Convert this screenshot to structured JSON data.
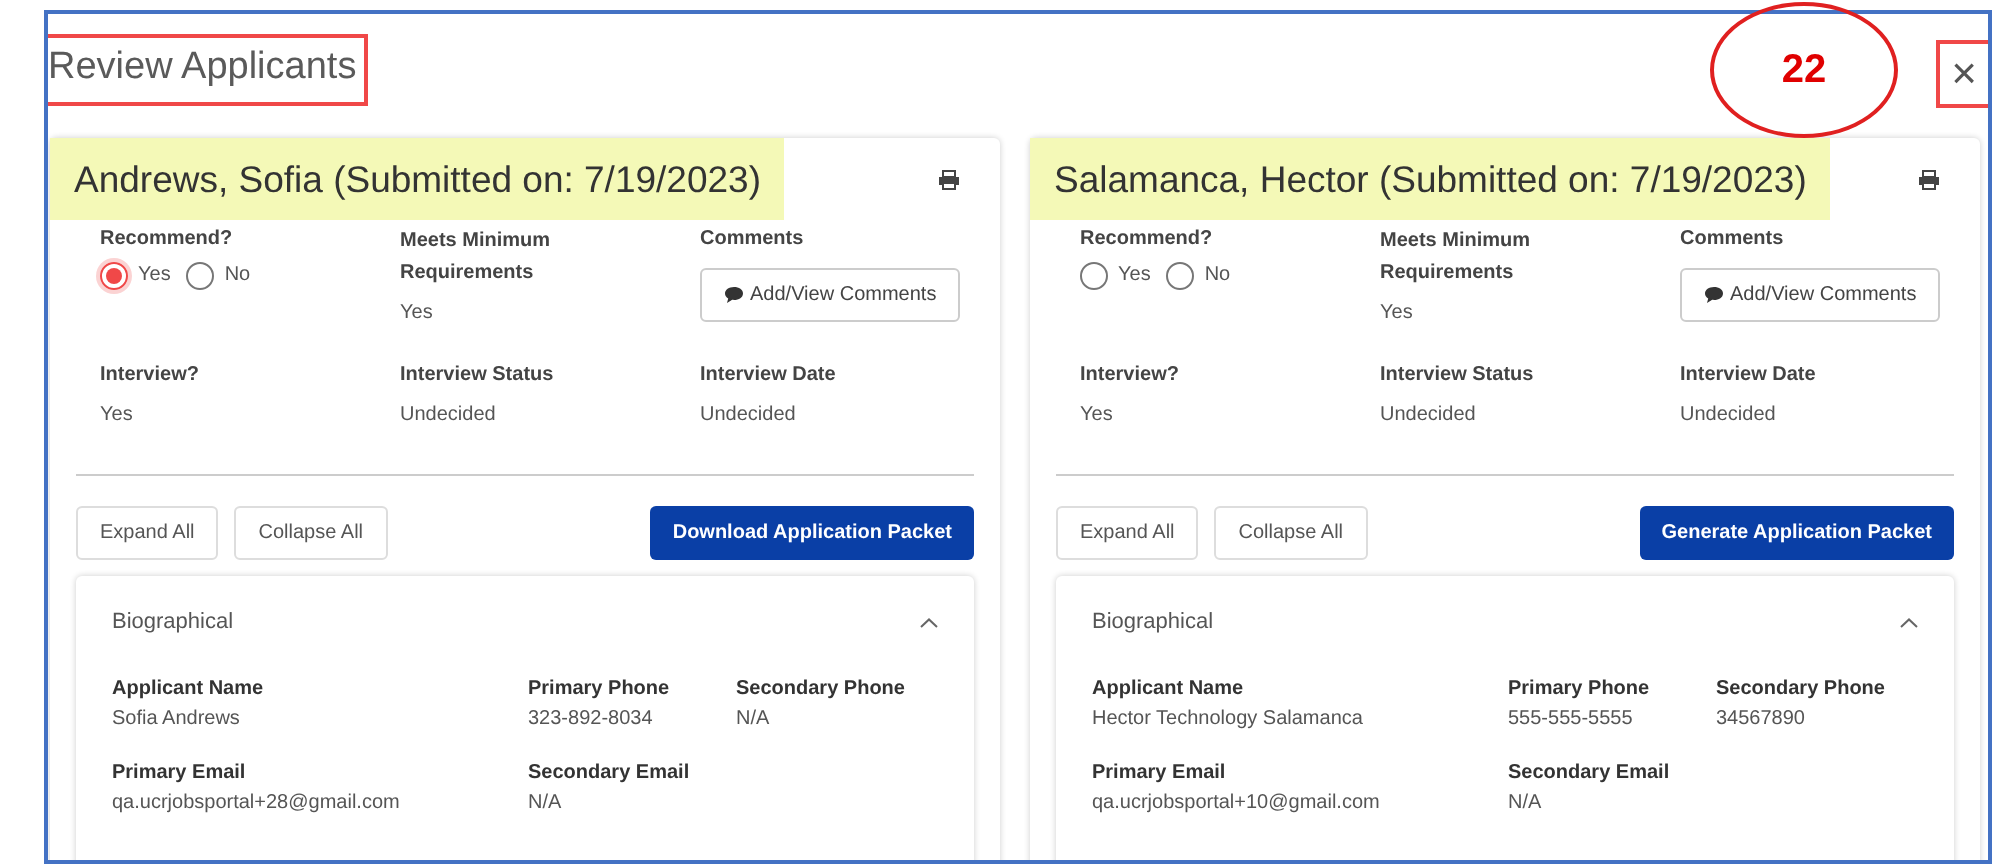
{
  "window": {
    "title": "Review Applicants",
    "close": "×"
  },
  "annotation": {
    "label": "22"
  },
  "applicants": [
    {
      "header": "Andrews, Sofia (Submitted on: 7/19/2023)",
      "recommend": {
        "label": "Recommend?",
        "options": [
          {
            "label": "Yes",
            "selected": true
          },
          {
            "label": "No",
            "selected": false
          }
        ]
      },
      "meets": {
        "label": "Meets Minimum Requirements",
        "value": "Yes"
      },
      "comments": {
        "label": "Comments",
        "button": "Add/View Comments"
      },
      "info": [
        {
          "label": "Interview?",
          "value": "Yes"
        },
        {
          "label": "Interview Status",
          "value": "Undecided"
        },
        {
          "label": "Interview Date",
          "value": "Undecided"
        }
      ],
      "buttons": [
        "Expand All",
        "Collapse All"
      ],
      "packet_button": "Download Application Packet",
      "section": {
        "title": "Biographical",
        "expanded": true,
        "fields": [
          {
            "label": "Applicant Name",
            "value": "Sofia Andrews"
          },
          {
            "label": "Primary Phone",
            "value": "323-892-8034"
          },
          {
            "label": "Secondary Phone",
            "value": "N/A"
          },
          {
            "label": "Primary Email",
            "value": "qa.ucrjobsportal+28@gmail.com"
          },
          {
            "label": "Secondary Email",
            "value": "N/A"
          }
        ]
      }
    },
    {
      "header": "Salamanca, Hector (Submitted on: 7/19/2023)",
      "recommend": {
        "label": "Recommend?",
        "options": [
          {
            "label": "Yes",
            "selected": false
          },
          {
            "label": "No",
            "selected": false
          }
        ]
      },
      "meets": {
        "label": "Meets Minimum Requirements",
        "value": "Yes"
      },
      "comments": {
        "label": "Comments",
        "button": "Add/View Comments"
      },
      "info": [
        {
          "label": "Interview?",
          "value": "Yes"
        },
        {
          "label": "Interview Status",
          "value": "Undecided"
        },
        {
          "label": "Interview Date",
          "value": "Undecided"
        }
      ],
      "buttons": [
        "Expand All",
        "Collapse All"
      ],
      "packet_button": "Generate Application Packet",
      "section": {
        "title": "Biographical",
        "expanded": true,
        "fields": [
          {
            "label": "Applicant Name",
            "value": "Hector Technology Salamanca"
          },
          {
            "label": "Primary Phone",
            "value": "555-555-5555"
          },
          {
            "label": "Secondary Phone",
            "value": "34567890"
          },
          {
            "label": "Primary Email",
            "value": "qa.ucrjobsportal+10@gmail.com"
          },
          {
            "label": "Secondary Email",
            "value": "N/A"
          }
        ]
      }
    }
  ]
}
